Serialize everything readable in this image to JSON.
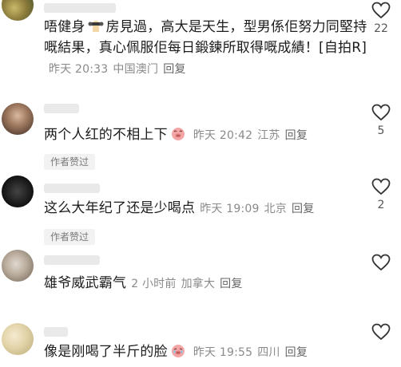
{
  "comments": [
    {
      "text_parts": [
        "唔健身",
        "房見過，高大是天生，型男係佢努力同堅持嘅結果，真心佩服佢每日鍛鍊所取得嘅成績！[自拍R]"
      ],
      "emoji": "strong-arm-emoji",
      "time": "昨天 20:33",
      "location": "中国澳门",
      "reply": "回复",
      "likes": "22",
      "author_liked": ""
    },
    {
      "text": "两个人红的不相上下",
      "emoji": "laughing-pig-emoji",
      "time": "昨天 20:42",
      "location": "江苏",
      "reply": "回复",
      "likes": "5",
      "author_liked": "作者赞过"
    },
    {
      "text": "这么大年纪了还是少喝点",
      "time": "昨天 19:09",
      "location": "北京",
      "reply": "回复",
      "likes": "2",
      "author_liked": "作者赞过"
    },
    {
      "text": "雄爷威武霸气",
      "time": "2 小时前",
      "location": "加拿大",
      "reply": "回复",
      "likes": "",
      "author_liked": ""
    },
    {
      "text": "像是刚喝了半斤的脸",
      "emoji": "crying-pig-emoji",
      "time": "昨天 19:55",
      "location": "四川",
      "reply": "回复",
      "likes": "",
      "author_liked": ""
    }
  ],
  "colors": {
    "meta": "#8a8a8a",
    "text": "#1c1c1c",
    "badge_bg": "#f2f2f2"
  }
}
